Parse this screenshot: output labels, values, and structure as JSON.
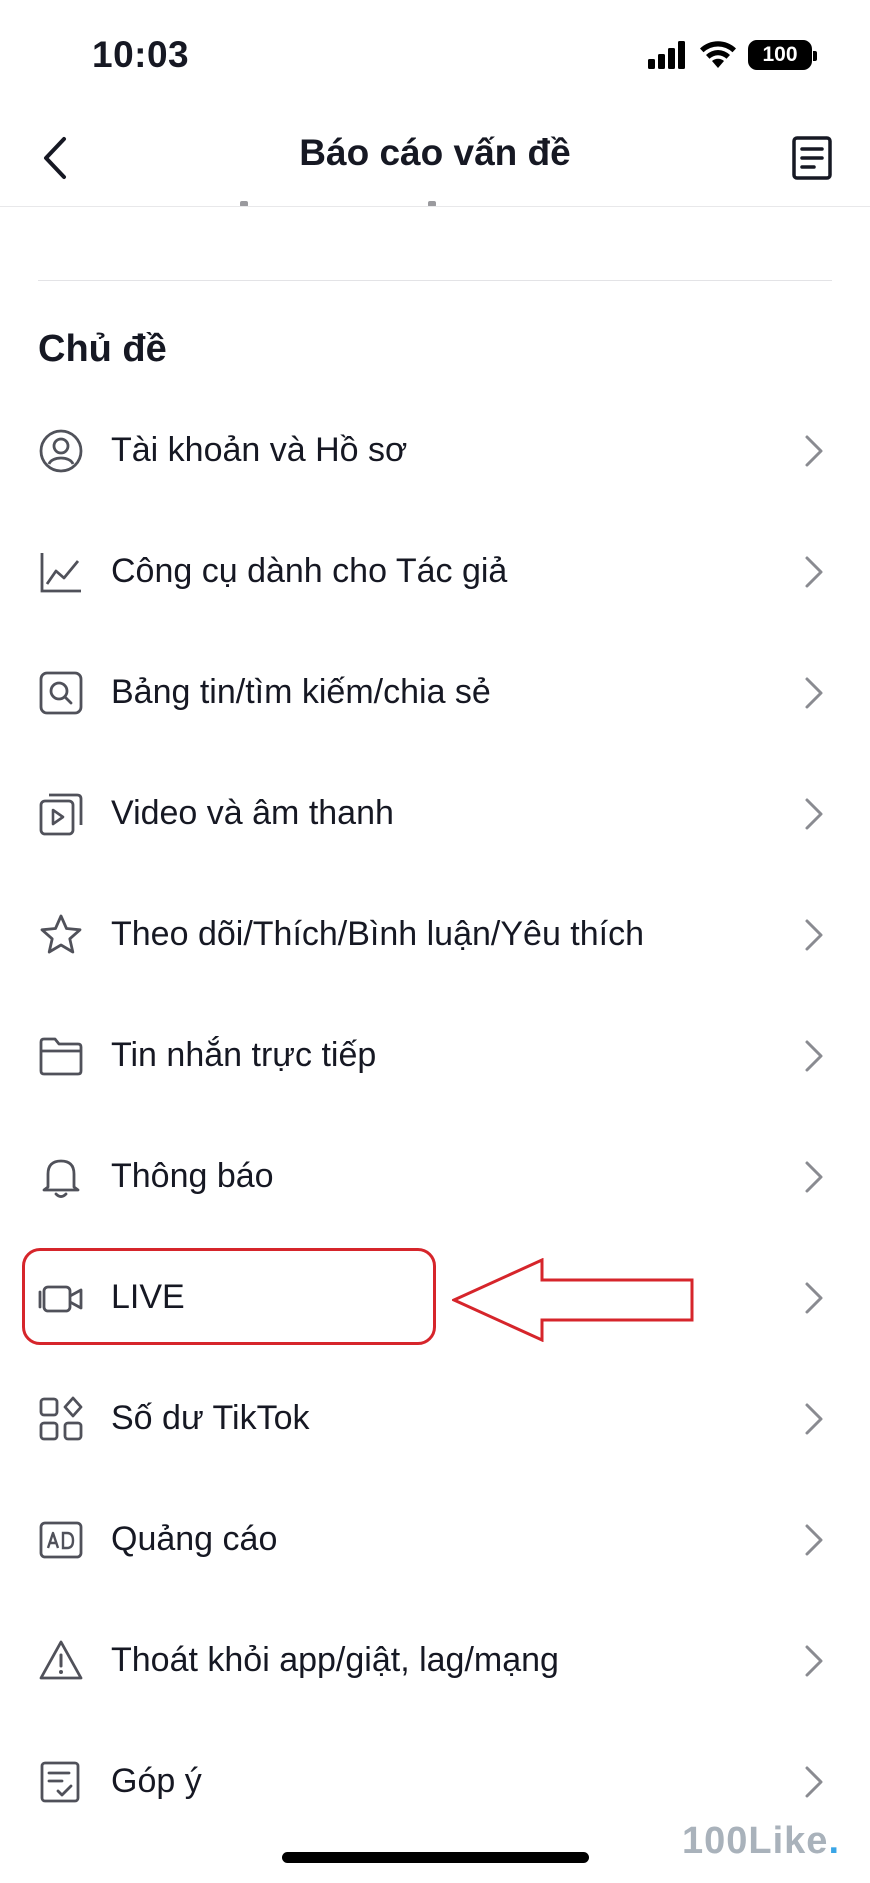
{
  "status_bar": {
    "time": "10:03",
    "battery": "100"
  },
  "nav": {
    "title": "Báo cáo vấn đề"
  },
  "section": {
    "title": "Chủ đề"
  },
  "topics": [
    {
      "label": "Tài khoản và Hồ sơ",
      "icon": "user-circle-icon"
    },
    {
      "label": "Công cụ dành cho Tác giả",
      "icon": "chart-line-icon"
    },
    {
      "label": "Bảng tin/tìm kiếm/chia sẻ",
      "icon": "search-box-icon"
    },
    {
      "label": "Video và âm thanh",
      "icon": "video-play-icon"
    },
    {
      "label": "Theo dõi/Thích/Bình luận/Yêu thích",
      "icon": "star-icon"
    },
    {
      "label": "Tin nhắn trực tiếp",
      "icon": "folder-icon"
    },
    {
      "label": "Thông báo",
      "icon": "bell-icon"
    },
    {
      "label": "LIVE",
      "icon": "live-camera-icon"
    },
    {
      "label": "Số dư TikTok",
      "icon": "apps-grid-icon"
    },
    {
      "label": "Quảng cáo",
      "icon": "ad-icon"
    },
    {
      "label": "Thoát khỏi app/giật, lag/mạng",
      "icon": "warning-triangle-icon"
    },
    {
      "label": "Góp ý",
      "icon": "feedback-icon"
    }
  ],
  "annotation": {
    "highlighted_item": "LIVE",
    "color": "#d6252b"
  },
  "watermark": {
    "text": "100Like",
    "dot": "."
  }
}
